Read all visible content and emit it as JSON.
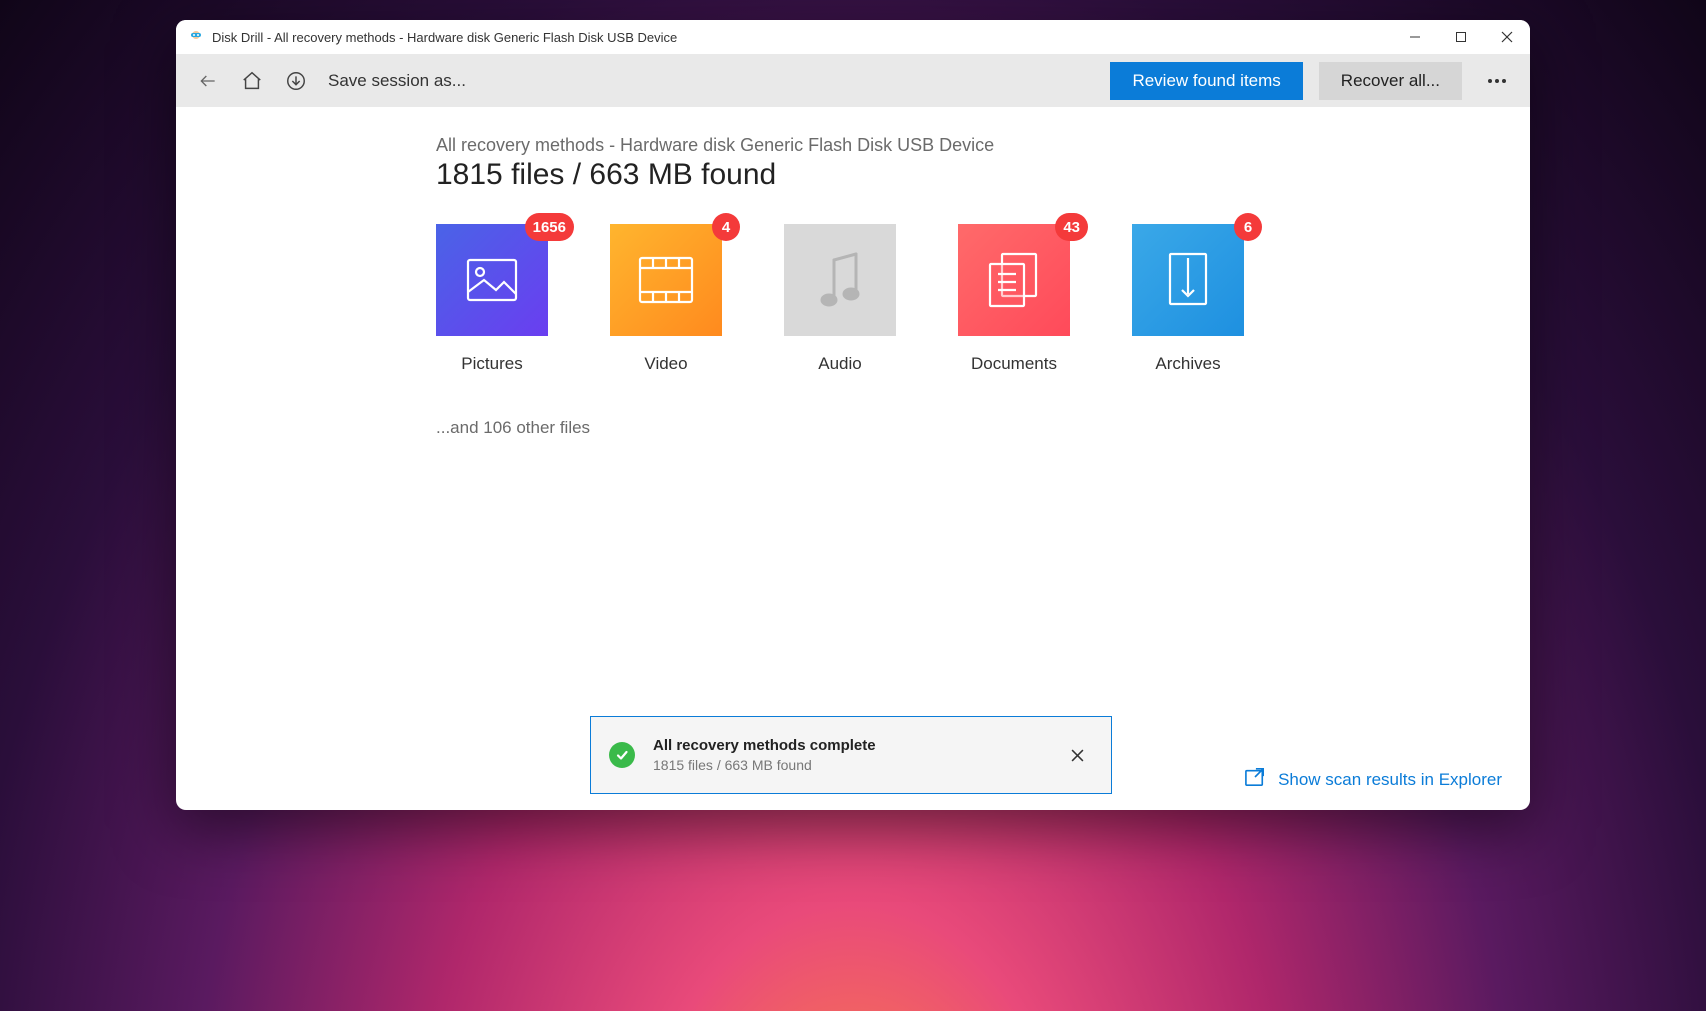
{
  "window": {
    "title": "Disk Drill - All recovery methods - Hardware disk Generic Flash Disk USB Device"
  },
  "toolbar": {
    "save_session_label": "Save session as...",
    "review_label": "Review found items",
    "recover_label": "Recover all..."
  },
  "main": {
    "breadcrumb": "All recovery methods - Hardware disk Generic Flash Disk USB Device",
    "headline": "1815 files / 663 MB found",
    "other_files": "...and 106 other files"
  },
  "categories": [
    {
      "key": "pictures",
      "label": "Pictures",
      "count": 1656
    },
    {
      "key": "video",
      "label": "Video",
      "count": 4
    },
    {
      "key": "audio",
      "label": "Audio",
      "count": null
    },
    {
      "key": "documents",
      "label": "Documents",
      "count": 43
    },
    {
      "key": "archives",
      "label": "Archives",
      "count": 6
    }
  ],
  "notification": {
    "title": "All recovery methods complete",
    "subtitle": "1815 files / 663 MB found"
  },
  "footer": {
    "show_in_explorer": "Show scan results in Explorer"
  }
}
